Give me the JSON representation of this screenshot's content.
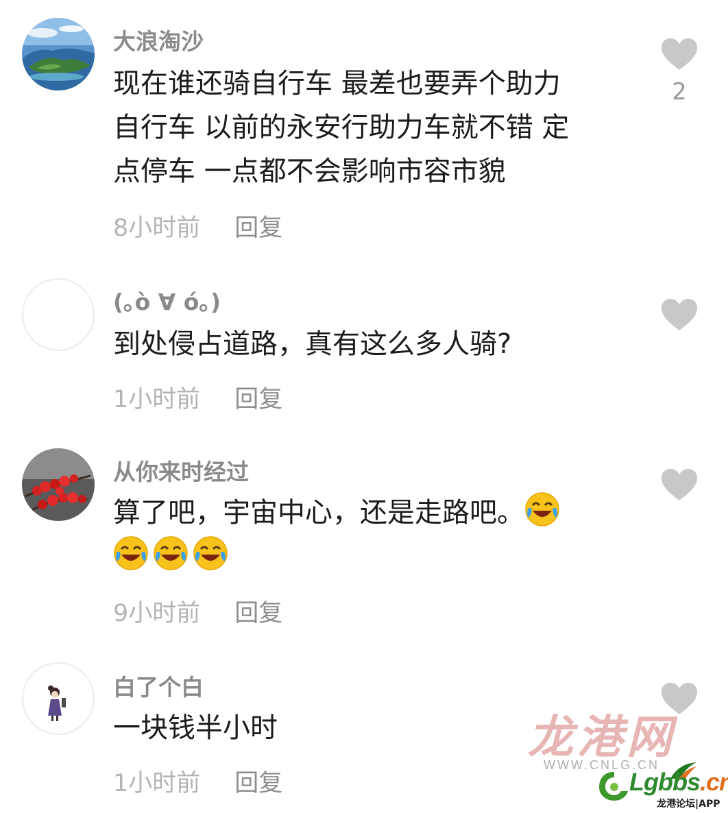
{
  "comments": [
    {
      "username": "大浪淘沙",
      "lines": [
        "现在谁还骑自行车 最差也要弄个助力",
        "自行车 以前的永安行助力车就不错 定",
        "点停车 一点都不会影响市容市貌"
      ],
      "time": "8小时前",
      "reply": "回复",
      "likes": "2",
      "avatar": "island-landscape-avatar"
    },
    {
      "username": "(｡ò ∀ ó｡)",
      "lines": [
        "到处侵占道路，真有这么多人骑?"
      ],
      "time": "1小时前",
      "reply": "回复",
      "likes": "",
      "avatar": "blank-avatar"
    },
    {
      "username": "从你来时经过",
      "lines": [
        "算了吧，宇宙中心，还是走路吧。"
      ],
      "emoji": "laughing-crying-emoji",
      "emoji_count": 4,
      "time": "9小时前",
      "reply": "回复",
      "likes": "",
      "avatar": "red-berries-avatar"
    },
    {
      "username": "白了个白",
      "lines": [
        "一块钱半小时"
      ],
      "time": "1小时前",
      "reply": "回复",
      "likes": "",
      "avatar": "cartoon-girl-avatar"
    }
  ],
  "icons": {
    "like": "heart-icon"
  },
  "watermark": {
    "site_cn": "龙港网",
    "site_url": "WWW.CNLG.CN",
    "logo_text_main": "Lgbbs",
    "logo_text_dot": ".cn",
    "logo_sub": "龙港论坛|APP"
  },
  "colors": {
    "username": "#8a8a8a",
    "text": "#1b1b1b",
    "meta": "#b4b4b4",
    "heart": "#c8c8c8"
  }
}
